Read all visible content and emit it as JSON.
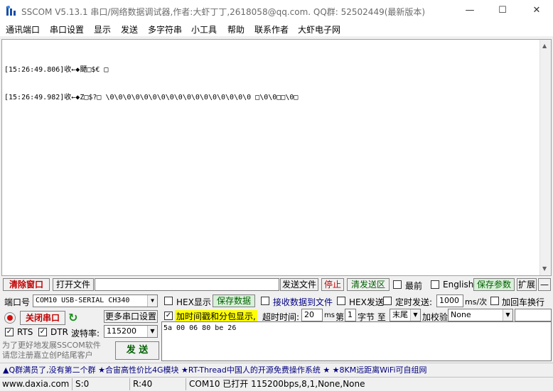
{
  "window": {
    "title": "SSCOM V5.13.1 串口/网络数据调试器,作者:大虾丁丁,2618058@qq.com. QQ群: 52502449(最新版本)",
    "minimize": "—",
    "maximize": "☐",
    "close": "✕"
  },
  "menu": [
    "通讯端口",
    "串口设置",
    "显示",
    "发送",
    "多字符串",
    "小工具",
    "帮助",
    "联系作者",
    "大虾电子网"
  ],
  "receive": {
    "lines": [
      "[15:26:49.806]收←◆飃□$€ □",
      "[15:26:49.982]收←◆Z□$?□ \\0\\0\\0\\0\\0\\0\\0\\0\\0\\0\\0\\0\\0\\0\\0\\0\\0 □\\0\\0□□\\0□"
    ]
  },
  "toolbar": {
    "clear_window": "清除窗口",
    "open_file": "打开文件",
    "send_file": "发送文件",
    "stop": "停止",
    "clear_send": "清发送区",
    "topmost": "最前",
    "english": "English",
    "save_params": "保存参数",
    "expand": "扩展",
    "collapse": "—"
  },
  "port": {
    "label": "端口号",
    "value": "COM10 USB-SERIAL CH340",
    "close_port": "关闭串口",
    "more_settings": "更多串口设置",
    "rts": "RTS",
    "dtr": "DTR",
    "baud_label": "波特率:",
    "baud_value": "115200"
  },
  "options": {
    "hex_display": "HEX显示",
    "save_data": "保存数据",
    "recv_to_file": "接收数据到文件",
    "hex_send": "HEX发送",
    "timed_send": "定时发送:",
    "interval": "1000",
    "interval_unit": "ms/次",
    "add_crlf": "加回车换行",
    "timestamp": "加时间戳和分包显示,",
    "timeout_label": "超时时间:",
    "timeout_value": "20",
    "timeout_unit": "ms",
    "nth_label": "第",
    "nth_value": "1",
    "byte_label": "字节 至",
    "end_value": "末尾",
    "checksum_label": "加校验",
    "checksum_value": "None"
  },
  "send": {
    "text": "5a 00 06 80 be 26",
    "button": "发 送"
  },
  "promo": "为了更好地发展SSCOM软件\n请您注册嘉立创P结尾客户",
  "ad": "▲Q群满员了,没有第二个群 ★合宙高性价比4G模块 ★RT-Thread中国人的开源免费操作系统 ★ ★8KM远距离WiFi可自组网",
  "status": {
    "site": "www.daxia.com",
    "sent": "S:0",
    "received": "R:40",
    "port_info": "COM10 已打开  115200bps,8,1,None,None"
  },
  "colors": {
    "accent_red": "#c00000",
    "accent_green": "#006000",
    "timestamp_highlight": "#ffff00",
    "ad_blue": "#000080"
  }
}
